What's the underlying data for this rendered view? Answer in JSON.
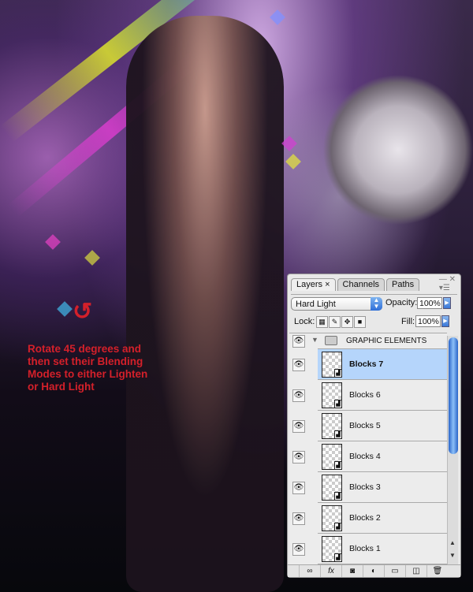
{
  "caption": "Rotate 45 degrees and then set their Blending Modes to either Lighten or Hard Light",
  "panel": {
    "tabs": [
      "Layers",
      "Channels",
      "Paths"
    ],
    "blend_mode": "Hard Light",
    "opacity_label": "Opacity:",
    "opacity": "100%",
    "lock_label": "Lock:",
    "fill_label": "Fill:",
    "fill": "100%",
    "group_name": "GRAPHIC ELEMENTS",
    "layers": [
      "Blocks 7",
      "Blocks 6",
      "Blocks 5",
      "Blocks 4",
      "Blocks 3",
      "Blocks 2",
      "Blocks 1"
    ],
    "selected_layer": "Blocks 7"
  },
  "colors": {
    "caption": "#d4202a",
    "selection": "#b5d5fb"
  }
}
